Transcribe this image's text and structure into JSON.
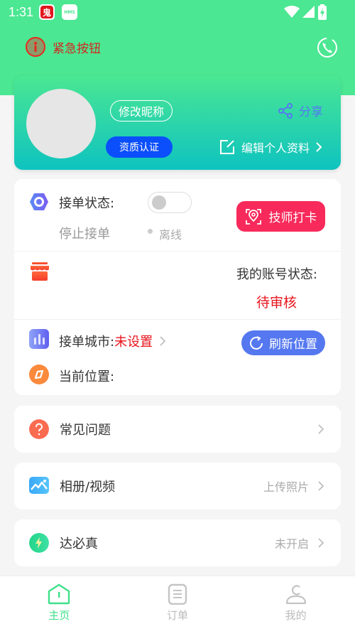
{
  "status_bar": {
    "time": "1:31",
    "notification_icons": [
      "app-red-icon",
      "hms-icon"
    ],
    "hms_label": "HMS",
    "app_red_glyph": "鬼"
  },
  "header": {
    "emergency_label": "紧急按钮",
    "emergency_icon": "info-alert-icon",
    "phone_icon": "phone-icon"
  },
  "profile": {
    "edit_nickname_label": "修改昵称",
    "certification_label": "资质认证",
    "share_label": "分享",
    "edit_profile_label": "编辑个人资料"
  },
  "status_card": {
    "order_status_label": "接单状态:",
    "order_toggle_on": false,
    "order_state_text": "停止接单",
    "online_state_text": "离线",
    "punch_in_label": "技师打卡",
    "account_status_label": "我的账号状态:",
    "account_status_value": "待审核",
    "city_label": "接单城市:",
    "city_value": "未设置",
    "refresh_location_label": "刷新位置",
    "current_location_label": "当前位置:"
  },
  "menu": [
    {
      "label": "常见问题",
      "hint": "",
      "icon": "question-icon"
    },
    {
      "label": "相册/视频",
      "hint": "上传照片",
      "icon": "photo-album-icon"
    },
    {
      "label": "达必真",
      "hint": "未开启",
      "icon": "lightning-icon"
    }
  ],
  "tabbar": {
    "items": [
      {
        "label": "主页",
        "active": true
      },
      {
        "label": "订单",
        "active": false
      },
      {
        "label": "我的",
        "active": false
      }
    ]
  },
  "colors": {
    "brand_green": "#4be792",
    "teal": "#0ec3c0",
    "punch_red": "#f72a5b",
    "refresh_blue": "#5578f0",
    "cert_blue": "#0a4ffb",
    "warning_red": "#e8141c"
  }
}
